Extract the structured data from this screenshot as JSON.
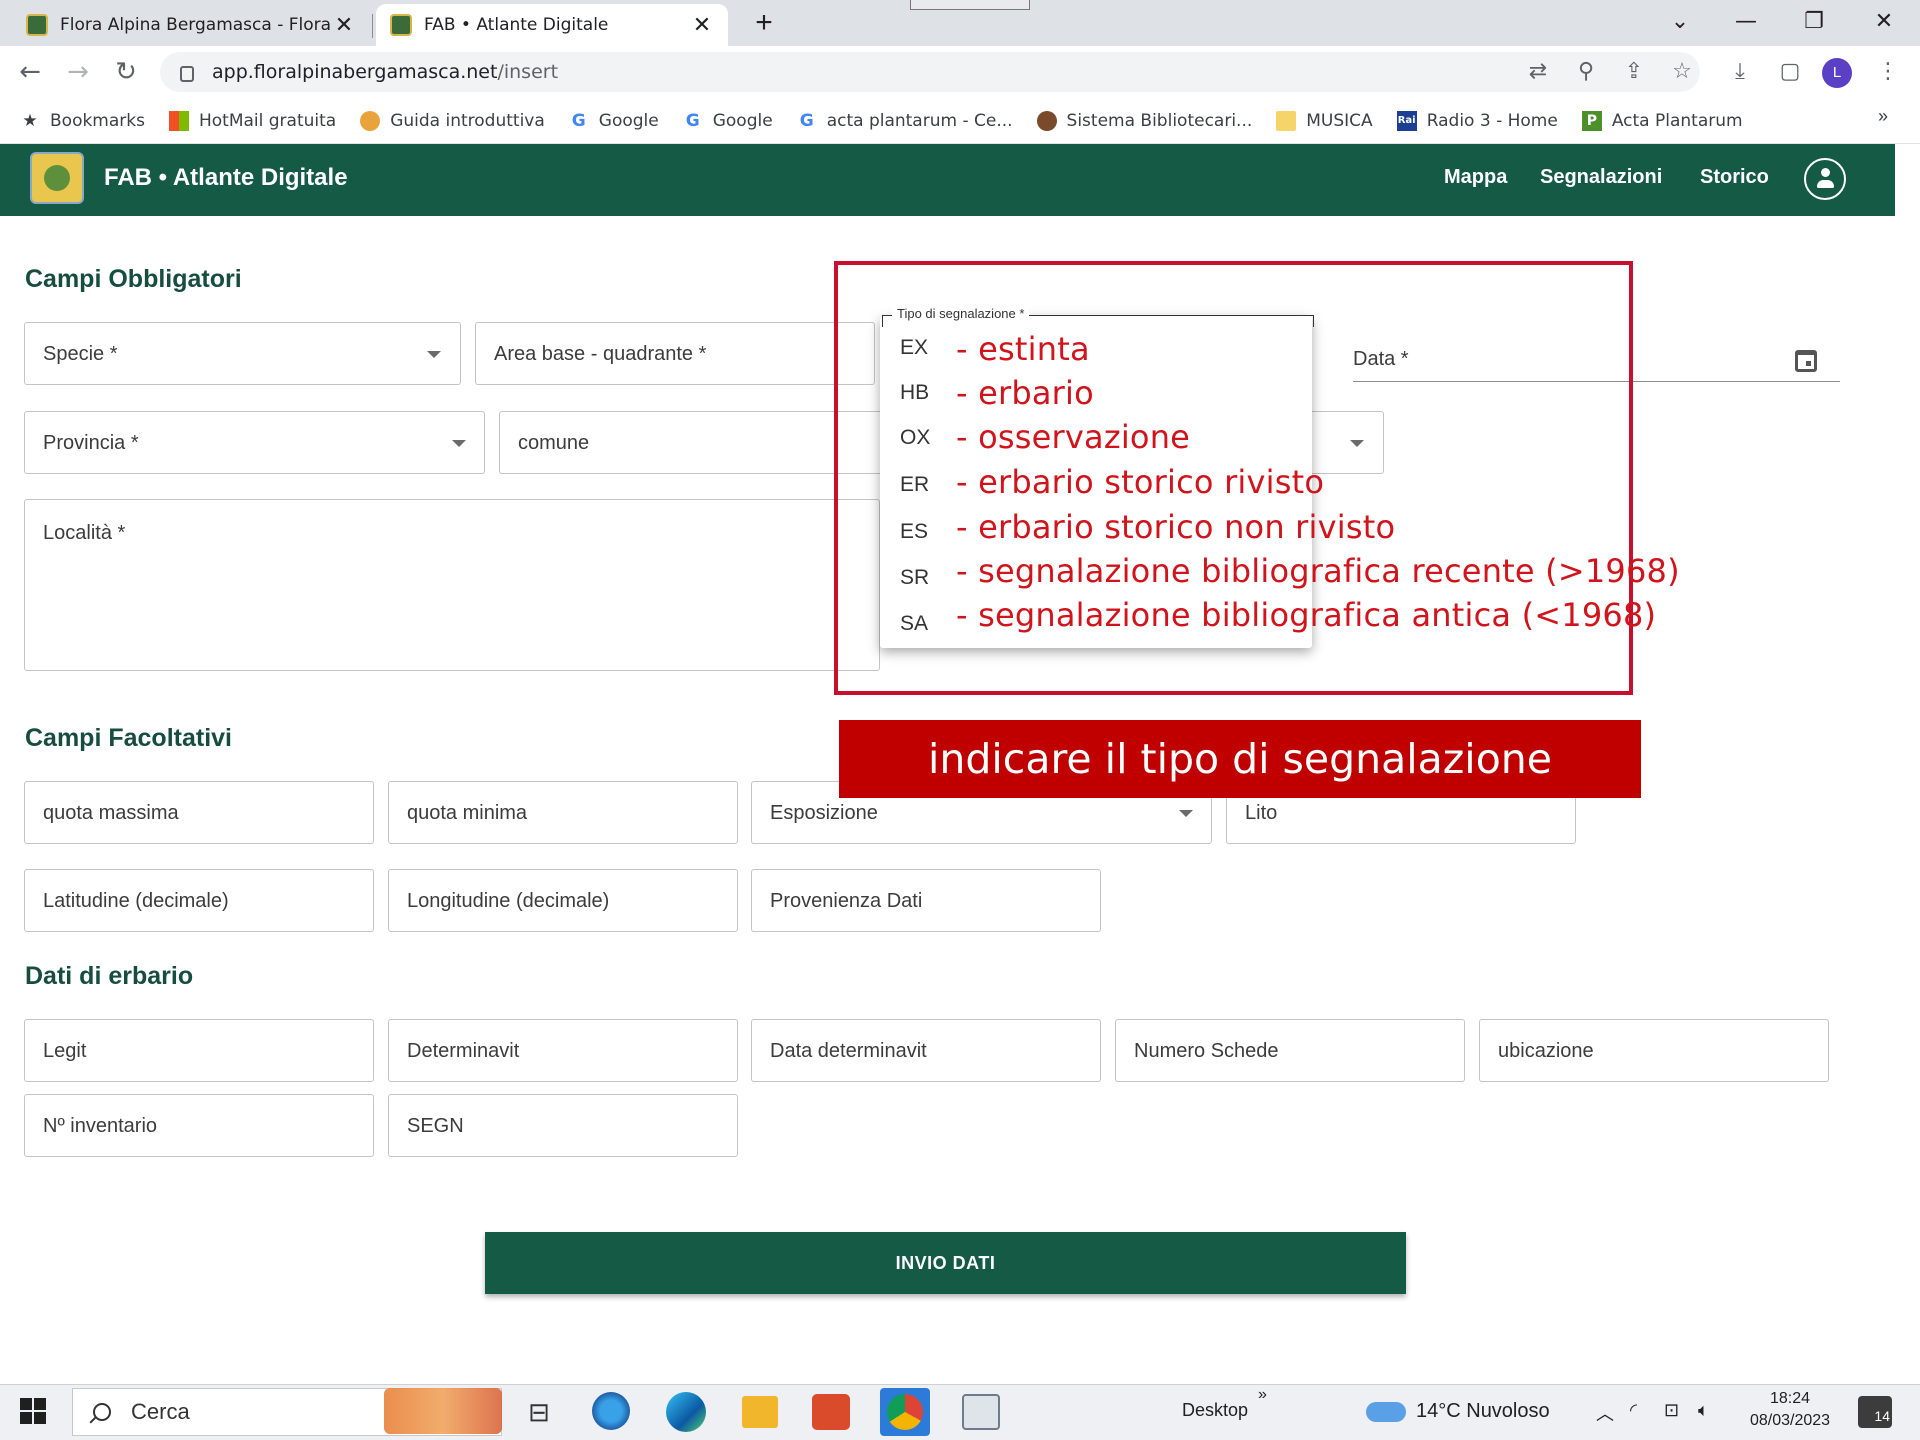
{
  "browser": {
    "tabs": [
      {
        "title": "Flora Alpina Bergamasca - Flora A"
      },
      {
        "title": "FAB • Atlante Digitale"
      }
    ],
    "url_host": "app.floralpinabergamasca.net",
    "url_path": "/insert",
    "profile_initial": "L",
    "bookmarks": [
      {
        "label": "Bookmarks",
        "icon": "star-icon"
      },
      {
        "label": "HotMail gratuita",
        "icon": "windows-icon"
      },
      {
        "label": "Guida introduttiva",
        "icon": "chrome-icon"
      },
      {
        "label": "Google",
        "icon": "google-icon"
      },
      {
        "label": "Google",
        "icon": "google-icon"
      },
      {
        "label": "acta plantarum - Ce...",
        "icon": "google-icon"
      },
      {
        "label": "Sistema Bibliotecari...",
        "icon": "owl-icon"
      },
      {
        "label": "MUSICA",
        "icon": "folder-icon"
      },
      {
        "label": "Radio 3 - Home",
        "icon": "rai-icon"
      },
      {
        "label": "Acta Plantarum",
        "icon": "acta-icon"
      }
    ],
    "bookmarks_more": "»"
  },
  "app": {
    "title": "FAB • Atlante Digitale",
    "nav": [
      "Mappa",
      "Segnalazioni",
      "Storico"
    ]
  },
  "form": {
    "required_title": "Campi Obbligatori",
    "specie": "Specie *",
    "area_base": "Area base - quadrante *",
    "data": "Data *",
    "provincia": "Provincia *",
    "comune": "comune",
    "localita": "Località *",
    "optional_title": "Campi Facoltativi",
    "quota_massima": "quota massima",
    "quota_minima": "quota minima",
    "esposizione": "Esposizione",
    "lito": "Lito",
    "latitudine": "Latitudine (decimale)",
    "longitudine": "Longitudine (decimale)",
    "provenienza": "Provenienza Dati",
    "erbario_title": "Dati di erbario",
    "legit": "Legit",
    "determinavit": "Determinavit",
    "data_determinavit": "Data determinavit",
    "numero_schede": "Numero Schede",
    "ubicazione": "ubicazione",
    "inventario": "Nº inventario",
    "segn": "SEGN",
    "submit": "INVIO DATI"
  },
  "dropdown": {
    "label": "Tipo di segnalazione *",
    "options": [
      {
        "code": "EX",
        "desc": "- estinta"
      },
      {
        "code": "HB",
        "desc": "- erbario"
      },
      {
        "code": "OX",
        "desc": "- osservazione"
      },
      {
        "code": "ER",
        "desc": "- erbario storico rivisto"
      },
      {
        "code": "ES",
        "desc": "- erbario storico non rivisto"
      },
      {
        "code": "SR",
        "desc": "- segnalazione bibliografica recente (>1968)"
      },
      {
        "code": "SA",
        "desc": "- segnalazione bibliografica antica (<1968)"
      }
    ]
  },
  "annotation": {
    "banner": "indicare il tipo di segnalazione",
    "box_color": "#c8102e"
  },
  "taskbar": {
    "search": "Cerca",
    "desktop": "Desktop",
    "desktop_more": "»",
    "weather": "14°C  Nuvoloso",
    "time": "18:24",
    "date": "08/03/2023",
    "notifications": "14"
  },
  "colors": {
    "brand": "#155a45",
    "annotation_red": "#c00000",
    "option_text": "#d1141b"
  }
}
